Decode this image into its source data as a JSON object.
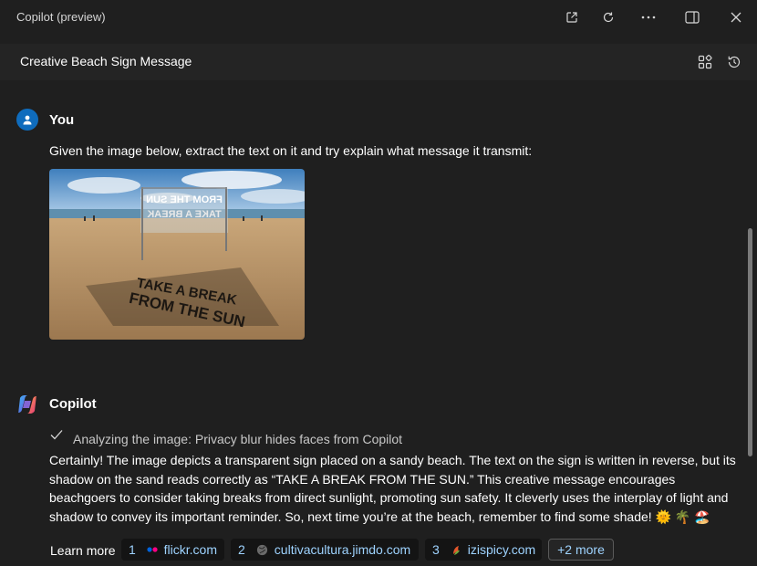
{
  "app": {
    "title": "Copilot (preview)"
  },
  "titlebar": {
    "buttons": [
      "open-external-icon",
      "refresh-icon",
      "more-icon",
      "sidebar-icon",
      "close-icon"
    ]
  },
  "header": {
    "conversation_title": "Creative Beach Sign Message",
    "buttons": [
      "plugins-icon",
      "history-icon"
    ]
  },
  "user_message": {
    "sender": "You",
    "text": "Given the image below, extract the text on it and try explain what message it transmit:",
    "image": {
      "sign_text_line1": "FROM THE SUN",
      "sign_text_line2": "TAKE A BREAK",
      "shadow_text_line1": "TAKE A BREAK",
      "shadow_text_line2": "FROM THE SUN"
    }
  },
  "copilot_message": {
    "sender": "Copilot",
    "status": "Analyzing the image: Privacy blur hides faces from Copilot",
    "answer": "Certainly! The image depicts a transparent sign placed on a sandy beach. The text on the sign is written in reverse, but its shadow on the sand reads correctly as “TAKE A BREAK FROM THE SUN.” This creative message encourages beachgoers to consider taking breaks from direct sunlight, promoting sun safety. It cleverly uses the interplay of light and shadow to convey its important reminder. So, next time you’re at the beach, remember to find some shade! 🌞 🌴 🏖️",
    "learn_more": {
      "label": "Learn more",
      "sources": [
        {
          "num": "1",
          "name": "flickr.com"
        },
        {
          "num": "2",
          "name": "cultivacultura.jimdo.com"
        },
        {
          "num": "3",
          "name": "izispicy.com"
        }
      ],
      "more_label": "+2 more"
    }
  },
  "colors": {
    "background": "#1f1f1f",
    "header_background": "#242424",
    "accent_link": "#9ed3ff",
    "avatar_blue": "#0f6cbd"
  }
}
